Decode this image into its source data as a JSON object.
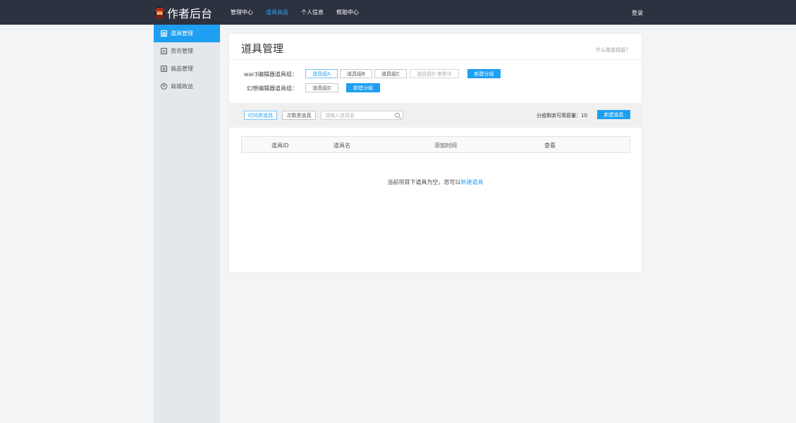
{
  "header": {
    "logo_text": "作者后台",
    "nav": [
      "管理中心",
      "道具商品",
      "个人信息",
      "帮助中心"
    ],
    "active_nav": "道具商品",
    "login": "登录"
  },
  "sidebar": {
    "items": [
      {
        "label": "道具管理",
        "icon": "grid-icon",
        "active": true
      },
      {
        "label": "货币管理",
        "icon": "card-icon",
        "active": false
      },
      {
        "label": "商品管理",
        "icon": "document-icon",
        "active": false
      },
      {
        "label": "商城收益",
        "icon": "coin-icon",
        "active": false
      }
    ]
  },
  "main": {
    "title": "道具管理",
    "help_link": "什么是道具组？",
    "groups": [
      {
        "label": "war3编辑器道具组：",
        "buttons": [
          "道具组A",
          "道具组B",
          "道具组C",
          "道具组D 审核中"
        ],
        "new_button": "新建分组"
      },
      {
        "label": "幻想编辑器道具组：",
        "buttons": [
          "道具组D"
        ],
        "new_button": "新建分组"
      }
    ],
    "filters": {
      "time_type": "时间类道具",
      "count_type": "次数类道具",
      "search_placeholder": "请输入道具名",
      "capacity_text": "分组剩余可用容量：10",
      "new_item_button": "新建道具"
    },
    "table": {
      "columns": [
        "道具ID",
        "道具名",
        "添加时间",
        "查看"
      ]
    },
    "empty_state": {
      "text": "当前项目下道具为空，您可以",
      "link": "新建道具"
    }
  },
  "colors": {
    "topbar": "#2c3240",
    "accent": "#1e9ff2",
    "sidebar": "#e4e7eb",
    "background": "#f3f4f6"
  }
}
